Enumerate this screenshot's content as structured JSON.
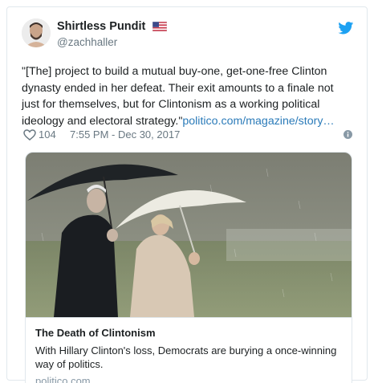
{
  "tweet": {
    "author": {
      "display_name": "Shirtless Pundit",
      "handle": "@zachhaller",
      "flag_icon": "us-flag-icon"
    },
    "text_lines": [
      "\"[The] project to build a mutual buy-one, get-one-free Clinton",
      "dynasty ended in her defeat. Their exit amounts to a finale not",
      "just for themselves, but for Clintonism as a working political",
      "ideology and electoral strategy.\""
    ],
    "link_text": "politico.com/magazine/story…",
    "likes": "104",
    "timestamp": "7:55 PM - Dec 30, 2017"
  },
  "card": {
    "title": "The Death of Clintonism",
    "description": "With Hillary Clinton's loss, Democrats are burying a once-winning way of politics.",
    "domain": "politico.com"
  },
  "colors": {
    "link": "#2b7bb9",
    "twitter_blue": "#1da1f2",
    "secondary_text": "#697882",
    "border": "#e1e8ed"
  }
}
